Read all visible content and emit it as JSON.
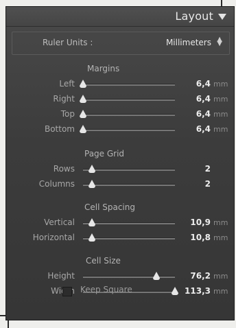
{
  "panel": {
    "title": "Layout",
    "toggle_icon": "triangle-down-icon"
  },
  "ruler_units": {
    "label": "Ruler Units :",
    "value": "Millimeters",
    "stepper_icon": "up-down-arrows-icon"
  },
  "sections": {
    "margins": {
      "title": "Margins",
      "rows": [
        {
          "label": "Left",
          "value": "6,4",
          "unit": "mm",
          "level": 0.0
        },
        {
          "label": "Right",
          "value": "6,4",
          "unit": "mm",
          "level": 0.0
        },
        {
          "label": "Top",
          "value": "6,4",
          "unit": "mm",
          "level": 0.0
        },
        {
          "label": "Bottom",
          "value": "6,4",
          "unit": "mm",
          "level": 0.0
        }
      ]
    },
    "page_grid": {
      "title": "Page Grid",
      "rows": [
        {
          "label": "Rows",
          "value": "2",
          "level": 0.1
        },
        {
          "label": "Columns",
          "value": "2",
          "level": 0.1
        }
      ]
    },
    "cell_spacing": {
      "title": "Cell Spacing",
      "rows": [
        {
          "label": "Vertical",
          "value": "10,9",
          "unit": "mm",
          "level": 0.1
        },
        {
          "label": "Horizontal",
          "value": "10,8",
          "unit": "mm",
          "level": 0.1
        }
      ]
    },
    "cell_size": {
      "title": "Cell Size",
      "rows": [
        {
          "label": "Height",
          "value": "76,2",
          "unit": "mm",
          "level": 0.8
        },
        {
          "label": "Width",
          "value": "113,3",
          "unit": "mm",
          "level": 1.0
        }
      ]
    }
  },
  "keep_square": {
    "label": "Keep Square",
    "checked": false
  }
}
